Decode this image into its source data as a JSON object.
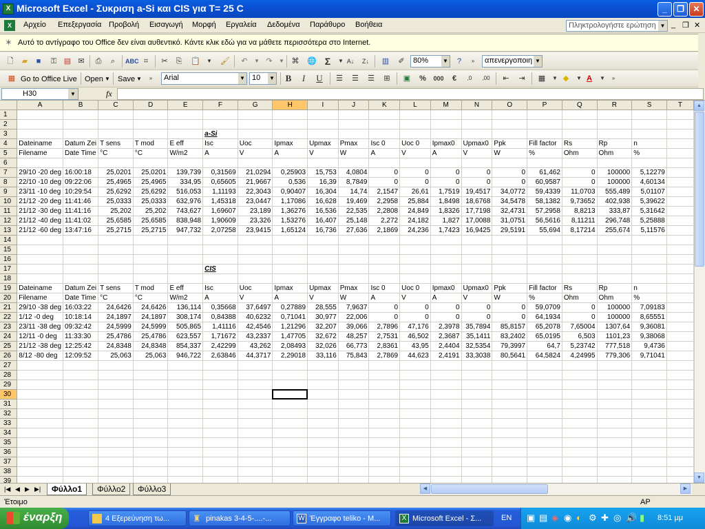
{
  "window": {
    "title": "Microsoft Excel - Συκριση a-Si και CIS για T= 25 C",
    "minimize": "_",
    "restore": "❐",
    "close": "✕"
  },
  "menu": {
    "items": [
      "Αρχείο",
      "Επεξεργασία",
      "Προβολή",
      "Εισαγωγή",
      "Μορφή",
      "Εργαλεία",
      "Δεδομένα",
      "Παράθυρο",
      "Βοήθεια"
    ],
    "help_placeholder": "Πληκτρολογήστε ερώτηση"
  },
  "infobar": {
    "text": "Αυτό το αντίγραφο του Office δεν είναι αυθεντικό. Κάντε κλικ εδώ για να μάθετε περισσότερα στο Internet."
  },
  "toolbar1": {
    "zoom": "80%",
    "style_box": "απενεργοποιη"
  },
  "toolbar2": {
    "office_live": "Go to Office Live",
    "open": "Open",
    "save": "Save",
    "font": "Arial",
    "size": "10"
  },
  "formula_bar": {
    "name_box": "H30",
    "fx": "fx",
    "value": ""
  },
  "sheet": {
    "columns": [
      "A",
      "B",
      "C",
      "D",
      "E",
      "F",
      "G",
      "H",
      "I",
      "J",
      "K",
      "L",
      "M",
      "N",
      "O",
      "P",
      "Q",
      "R",
      "S",
      "T"
    ],
    "selected_cell": "H30",
    "section_asi": "a-Si",
    "section_cis": "CIS",
    "header_names": [
      "Dateiname",
      "Datum Zei",
      "T sens",
      "T mod",
      "E eff",
      "Isc",
      "Uoc",
      "Ipmax",
      "Upmax",
      "Pmax",
      "Isc 0",
      "Uoc 0",
      "Ipmax0",
      "Upmax0",
      "Ppk",
      "Fill factor",
      "Rs",
      "Rp",
      "n"
    ],
    "header_units": [
      "Filename",
      "Date Time",
      "°C",
      "°C",
      "W/m2",
      "A",
      "V",
      "A",
      "V",
      "W",
      "A",
      "V",
      "A",
      "V",
      "W",
      "%",
      "Ohm",
      "Ohm",
      "%"
    ],
    "asi_rows": [
      [
        "29/10 -20 deg",
        "16:00:18",
        "25,0201",
        "25,0201",
        "139,739",
        "0,31569",
        "21,0294",
        "0,25903",
        "15,753",
        "4,0804",
        "0",
        "0",
        "0",
        "0",
        "0",
        "61,462",
        "0",
        "100000",
        "5,12279"
      ],
      [
        "22/10 -10 deg",
        "09:22:06",
        "25,4965",
        "25,4965",
        "334,95",
        "0,65605",
        "21,9667",
        "0,536",
        "16,39",
        "8,7849",
        "0",
        "0",
        "0",
        "0",
        "0",
        "60,9587",
        "0",
        "100000",
        "4,60134"
      ],
      [
        "23/11 -10 deg",
        "10:29:54",
        "25,6292",
        "25,6292",
        "516,053",
        "1,11193",
        "22,3043",
        "0,90407",
        "16,304",
        "14,74",
        "2,1547",
        "26,61",
        "1,7519",
        "19,4517",
        "34,0772",
        "59,4339",
        "11,0703",
        "555,489",
        "5,01107"
      ],
      [
        "21/12 -20 deg",
        "11:41:46",
        "25,0333",
        "25,0333",
        "632,976",
        "1,45318",
        "23,0447",
        "1,17086",
        "16,628",
        "19,469",
        "2,2958",
        "25,884",
        "1,8498",
        "18,6768",
        "34,5478",
        "58,1382",
        "9,73652",
        "402,938",
        "5,39622"
      ],
      [
        "21/12 -30 deg",
        "11:41:16",
        "25,202",
        "25,202",
        "743,627",
        "1,69607",
        "23,189",
        "1,36276",
        "16,536",
        "22,535",
        "2,2808",
        "24,849",
        "1,8326",
        "17,7198",
        "32,4731",
        "57,2958",
        "8,8213",
        "333,87",
        "5,31642"
      ],
      [
        "21/12 -40 deg",
        "11:41:02",
        "25,6585",
        "25,6585",
        "838,948",
        "1,90609",
        "23,326",
        "1,53276",
        "16,407",
        "25,148",
        "2,272",
        "24,182",
        "1,827",
        "17,0088",
        "31,0751",
        "56,5616",
        "8,11211",
        "296,748",
        "5,25888"
      ],
      [
        "21/12 -60 deg",
        "13:47:16",
        "25,2715",
        "25,2715",
        "947,732",
        "2,07258",
        "23,9415",
        "1,65124",
        "16,736",
        "27,636",
        "2,1869",
        "24,236",
        "1,7423",
        "16,9425",
        "29,5191",
        "55,694",
        "8,17214",
        "255,674",
        "5,11576"
      ]
    ],
    "cis_rows": [
      [
        "29/10 -38 deg",
        "16:03:22",
        "24,6426",
        "24,6426",
        "136,114",
        "0,35668",
        "37,6497",
        "0,27889",
        "28,555",
        "7,9637",
        "0",
        "0",
        "0",
        "0",
        "0",
        "59,0709",
        "0",
        "100000",
        "7,09183"
      ],
      [
        "1/12 -0 deg",
        "10:18:14",
        "24,1897",
        "24,1897",
        "308,174",
        "0,84388",
        "40,6232",
        "0,71041",
        "30,977",
        "22,006",
        "0",
        "0",
        "0",
        "0",
        "0",
        "64,1934",
        "0",
        "100000",
        "8,65551"
      ],
      [
        "23/11 -38 deg",
        "09:32:42",
        "24,5999",
        "24,5999",
        "505,865",
        "1,41116",
        "42,4546",
        "1,21296",
        "32,207",
        "39,066",
        "2,7896",
        "47,176",
        "2,3978",
        "35,7894",
        "85,8157",
        "65,2078",
        "7,65004",
        "1307,64",
        "9,36081"
      ],
      [
        "12/11 -0 deg",
        "11:33:30",
        "25,4786",
        "25,4786",
        "623,557",
        "1,71672",
        "43,2337",
        "1,47705",
        "32,672",
        "48,257",
        "2,7531",
        "46,502",
        "2,3687",
        "35,1411",
        "83,2402",
        "65,0195",
        "6,503",
        "1101,23",
        "9,38068"
      ],
      [
        "21/12 -38 deg",
        "12:25:42",
        "24,8348",
        "24,8348",
        "854,337",
        "2,42299",
        "43,262",
        "2,08493",
        "32,026",
        "66,773",
        "2,8361",
        "43,95",
        "2,4404",
        "32,5354",
        "79,3997",
        "64,7",
        "5,23742",
        "777,518",
        "9,4736"
      ],
      [
        "8/12 -80 deg",
        "12:09:52",
        "25,063",
        "25,063",
        "946,722",
        "2,63846",
        "44,3717",
        "2,29018",
        "33,116",
        "75,843",
        "2,7869",
        "44,623",
        "2,4191",
        "33,3038",
        "80,5641",
        "64,5824",
        "4,24995",
        "779,306",
        "9,71041"
      ]
    ]
  },
  "sheet_tabs": [
    "Φύλλο1",
    "Φύλλο2",
    "Φύλλο3"
  ],
  "status": {
    "left": "Έτοιμο",
    "right": "ΑΡ"
  },
  "taskbar": {
    "start": "έναρξη",
    "tasks": [
      "4 Εξερεύνηση τω...",
      "pinakas 3-4-5-....-...",
      "Έγγραφο teliko - M...",
      "Microsoft Excel - Σ..."
    ],
    "lang": "EN",
    "clock": "8:51 μμ"
  }
}
